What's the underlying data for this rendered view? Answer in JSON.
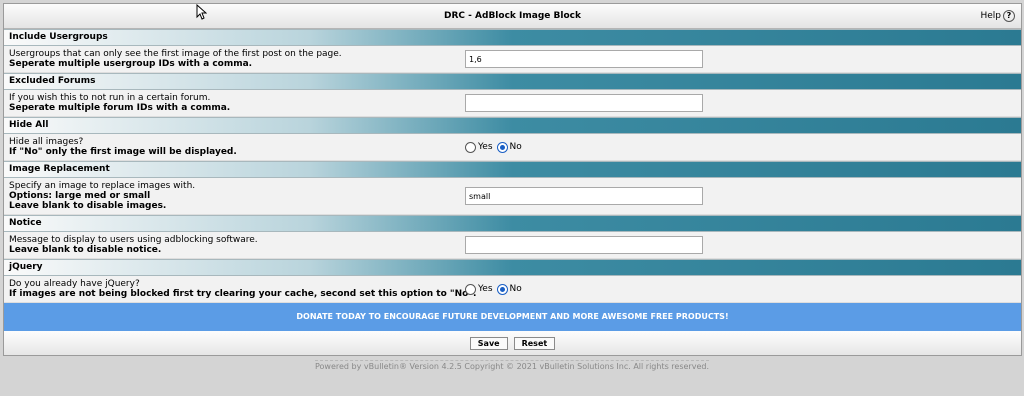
{
  "title": "DRC - AdBlock Image Block",
  "help_label": "Help",
  "sections": {
    "usergroups": {
      "heading": "Include Usergroups",
      "line1": "Usergroups that can only see the first image of the first post on the page.",
      "line2": "Seperate multiple usergroup IDs with a comma.",
      "value": "1,6"
    },
    "forums": {
      "heading": "Excluded Forums",
      "line1": "If you wish this to not run in a certain forum.",
      "line2": "Seperate multiple forum IDs with a comma.",
      "value": ""
    },
    "hideall": {
      "heading": "Hide All",
      "line1": "Hide all images?",
      "line2": "If \"No\" only the first image will be displayed.",
      "yes": "Yes",
      "no": "No",
      "selected": "No"
    },
    "replacement": {
      "heading": "Image Replacement",
      "line1": "Specify an image to replace images with.",
      "line2": "Options: large med or small",
      "line3": "Leave blank to disable images.",
      "value": "small"
    },
    "notice": {
      "heading": "Notice",
      "line1": "Message to display to users using adblocking software.",
      "line2": "Leave blank to disable notice.",
      "value": ""
    },
    "jquery": {
      "heading": "jQuery",
      "line1": "Do you already have jQuery?",
      "line2": "If images are not being blocked first try clearing your cache, second set this option to \"No\".",
      "yes": "Yes",
      "no": "No",
      "selected": "No"
    }
  },
  "donate": "DONATE TODAY TO ENCOURAGE FUTURE DEVELOPMENT AND MORE AWESOME FREE PRODUCTS!",
  "buttons": {
    "save": "Save",
    "reset": "Reset"
  },
  "footer": "Powered by vBulletin® Version 4.2.5 Copyright © 2021 vBulletin Solutions Inc. All rights reserved."
}
